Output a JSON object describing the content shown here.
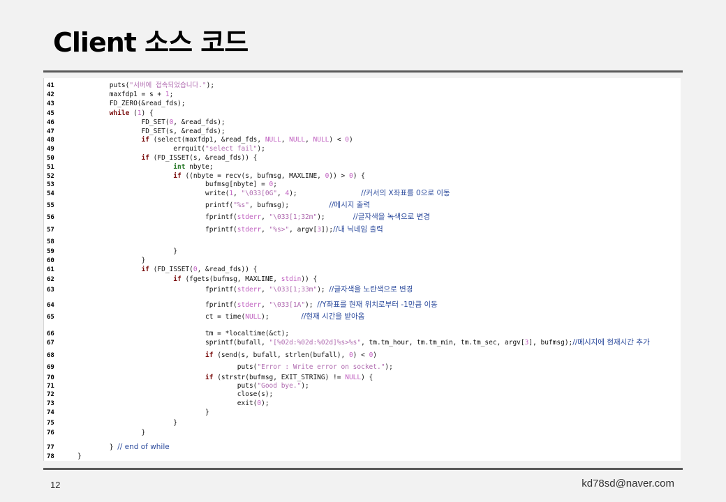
{
  "slide": {
    "title": "Client 소스 코드",
    "page_number": "12",
    "email": "kd78sd@naver.com"
  },
  "code": [
    {
      "n": "41",
      "segs": [
        [
          "",
          "        puts("
        ],
        [
          "str",
          "\"서버에 접속되었습니다.\""
        ],
        [
          "",
          ");"
        ]
      ]
    },
    {
      "n": "42",
      "segs": [
        [
          "",
          "        maxfdp1 = s + "
        ],
        [
          "num",
          "1"
        ],
        [
          "",
          ";"
        ]
      ]
    },
    {
      "n": "43",
      "segs": [
        [
          "",
          "        FD_ZERO(&read_fds);"
        ]
      ]
    },
    {
      "n": "45",
      "segs": [
        [
          "kw",
          "        while"
        ],
        [
          "",
          " ("
        ],
        [
          "num",
          "1"
        ],
        [
          "",
          ") {"
        ]
      ]
    },
    {
      "n": "46",
      "segs": [
        [
          "",
          "                FD_SET("
        ],
        [
          "num",
          "0"
        ],
        [
          "",
          ", &read_fds);"
        ]
      ]
    },
    {
      "n": "47",
      "segs": [
        [
          "",
          "                FD_SET(s, &read_fds);"
        ]
      ]
    },
    {
      "n": "48",
      "segs": [
        [
          "kw",
          "                if"
        ],
        [
          "",
          " (select(maxfdp1, &read_fds, "
        ],
        [
          "num",
          "NULL"
        ],
        [
          "",
          ", "
        ],
        [
          "num",
          "NULL"
        ],
        [
          "",
          ", "
        ],
        [
          "num",
          "NULL"
        ],
        [
          "",
          ") < "
        ],
        [
          "num",
          "0"
        ],
        [
          "",
          ")"
        ]
      ]
    },
    {
      "n": "49",
      "segs": [
        [
          "",
          "                        errquit("
        ],
        [
          "str",
          "\"select fail\""
        ],
        [
          "",
          ");"
        ]
      ]
    },
    {
      "n": "50",
      "segs": [
        [
          "kw",
          "                if"
        ],
        [
          "",
          " (FD_ISSET(s, &read_fds)) {"
        ]
      ]
    },
    {
      "n": "51",
      "segs": [
        [
          "ty",
          "                        int"
        ],
        [
          "",
          " nbyte;"
        ]
      ]
    },
    {
      "n": "52",
      "segs": [
        [
          "kw",
          "                        if"
        ],
        [
          "",
          " ((nbyte = recv(s, bufmsg, MAXLINE, "
        ],
        [
          "num",
          "0"
        ],
        [
          "",
          ")) > "
        ],
        [
          "num",
          "0"
        ],
        [
          "",
          ") {"
        ]
      ]
    },
    {
      "n": "53",
      "segs": [
        [
          "",
          "                                bufmsg[nbyte] = "
        ],
        [
          "num",
          "0"
        ],
        [
          "",
          ";"
        ]
      ]
    },
    {
      "n": "54",
      "segs": [
        [
          "",
          "                                write("
        ],
        [
          "num",
          "1"
        ],
        [
          "",
          ", "
        ],
        [
          "str",
          "\"\\033[0G\""
        ],
        [
          "",
          ", "
        ],
        [
          "num",
          "4"
        ],
        [
          "",
          ");                "
        ],
        [
          "cm",
          "//커서의 X좌표를 0으로 이동"
        ]
      ]
    },
    {
      "n": "55",
      "segs": [
        [
          "",
          "                                printf("
        ],
        [
          "str",
          "\"%s\""
        ],
        [
          "",
          ", bufmsg);          "
        ],
        [
          "cm",
          "//메시지 출력"
        ]
      ]
    },
    {
      "n": "56",
      "segs": [
        [
          "",
          "                                fprintf("
        ],
        [
          "num",
          "stderr"
        ],
        [
          "",
          ", "
        ],
        [
          "str",
          "\"\\033[1;32m\""
        ],
        [
          "",
          ");       "
        ],
        [
          "cm",
          "//글자색을 녹색으로 변경"
        ]
      ]
    },
    {
      "n": "57",
      "segs": [
        [
          "",
          "                                fprintf("
        ],
        [
          "num",
          "stderr"
        ],
        [
          "",
          ", "
        ],
        [
          "str",
          "\"%s>\""
        ],
        [
          "",
          ", argv["
        ],
        [
          "num",
          "3"
        ],
        [
          "",
          "]);"
        ],
        [
          "cm",
          "//내 닉네임 출력"
        ]
      ]
    },
    {
      "n": "58",
      "segs": [
        [
          "",
          ""
        ]
      ]
    },
    {
      "n": "59",
      "segs": [
        [
          "",
          "                        }"
        ]
      ]
    },
    {
      "n": "60",
      "segs": [
        [
          "",
          "                }"
        ]
      ]
    },
    {
      "n": "61",
      "segs": [
        [
          "kw",
          "                if"
        ],
        [
          "",
          " (FD_ISSET("
        ],
        [
          "num",
          "0"
        ],
        [
          "",
          ", &read_fds)) {"
        ]
      ]
    },
    {
      "n": "62",
      "segs": [
        [
          "kw",
          "                        if"
        ],
        [
          "",
          " (fgets(bufmsg, MAXLINE, "
        ],
        [
          "num",
          "stdin"
        ],
        [
          "",
          ")) {"
        ]
      ]
    },
    {
      "n": "63",
      "segs": [
        [
          "",
          "                                fprintf("
        ],
        [
          "num",
          "stderr"
        ],
        [
          "",
          ", "
        ],
        [
          "str",
          "\"\\033[1;33m\""
        ],
        [
          "",
          "); "
        ],
        [
          "cm",
          "//글자색을 노란색으로 변경"
        ]
      ]
    },
    {
      "n": "64",
      "segs": [
        [
          "",
          "                                fprintf("
        ],
        [
          "num",
          "stderr"
        ],
        [
          "",
          ", "
        ],
        [
          "str",
          "\"\\033[1A\""
        ],
        [
          "",
          "); "
        ],
        [
          "cm",
          "//Y좌표를 현재 위치로부터 -1만큼 이동"
        ]
      ]
    },
    {
      "n": "65",
      "segs": [
        [
          "",
          "                                ct = time("
        ],
        [
          "num",
          "NULL"
        ],
        [
          "",
          ");        "
        ],
        [
          "cm",
          "//현재 시간을 받아옴"
        ]
      ]
    },
    {
      "n": "66",
      "segs": [
        [
          "",
          "                                tm = *localtime(&ct);"
        ]
      ]
    },
    {
      "n": "67",
      "segs": [
        [
          "",
          "                                sprintf(bufall, "
        ],
        [
          "str",
          "\"[%02d:%02d:%02d]%s>%s\""
        ],
        [
          "",
          ", tm.tm_hour, tm.tm_min, tm.tm_sec, argv["
        ],
        [
          "num",
          "3"
        ],
        [
          "",
          "], bufmsg);"
        ],
        [
          "cm",
          "//메시지에 현재시간 추가"
        ]
      ]
    },
    {
      "n": "68",
      "segs": [
        [
          "kw",
          "                                if"
        ],
        [
          "",
          " (send(s, bufall, strlen(bufall), "
        ],
        [
          "num",
          "0"
        ],
        [
          "",
          ") < "
        ],
        [
          "num",
          "0"
        ],
        [
          "",
          ")"
        ]
      ]
    },
    {
      "n": "69",
      "segs": [
        [
          "",
          "                                        puts("
        ],
        [
          "str",
          "\"Error : Write error on socket.\""
        ],
        [
          "",
          ");"
        ]
      ]
    },
    {
      "n": "70",
      "segs": [
        [
          "kw",
          "                                if"
        ],
        [
          "",
          " (strstr(bufmsg, EXIT_STRING) != "
        ],
        [
          "num",
          "NULL"
        ],
        [
          "",
          ") {"
        ]
      ]
    },
    {
      "n": "71",
      "segs": [
        [
          "",
          "                                        puts("
        ],
        [
          "str",
          "\"Good bye.\""
        ],
        [
          "",
          ");"
        ]
      ]
    },
    {
      "n": "72",
      "segs": [
        [
          "",
          "                                        close(s);"
        ]
      ]
    },
    {
      "n": "73",
      "segs": [
        [
          "",
          "                                        exit("
        ],
        [
          "num",
          "0"
        ],
        [
          "",
          ");"
        ]
      ]
    },
    {
      "n": "74",
      "segs": [
        [
          "",
          "                                }"
        ]
      ]
    },
    {
      "n": "75",
      "segs": [
        [
          "",
          "                        }"
        ]
      ]
    },
    {
      "n": "76",
      "segs": [
        [
          "",
          "                }"
        ]
      ]
    },
    {
      "n": "77",
      "segs": [
        [
          "",
          "        } "
        ],
        [
          "cm",
          "// end of while"
        ]
      ]
    },
    {
      "n": "78",
      "segs": [
        [
          "",
          "}"
        ]
      ]
    }
  ]
}
